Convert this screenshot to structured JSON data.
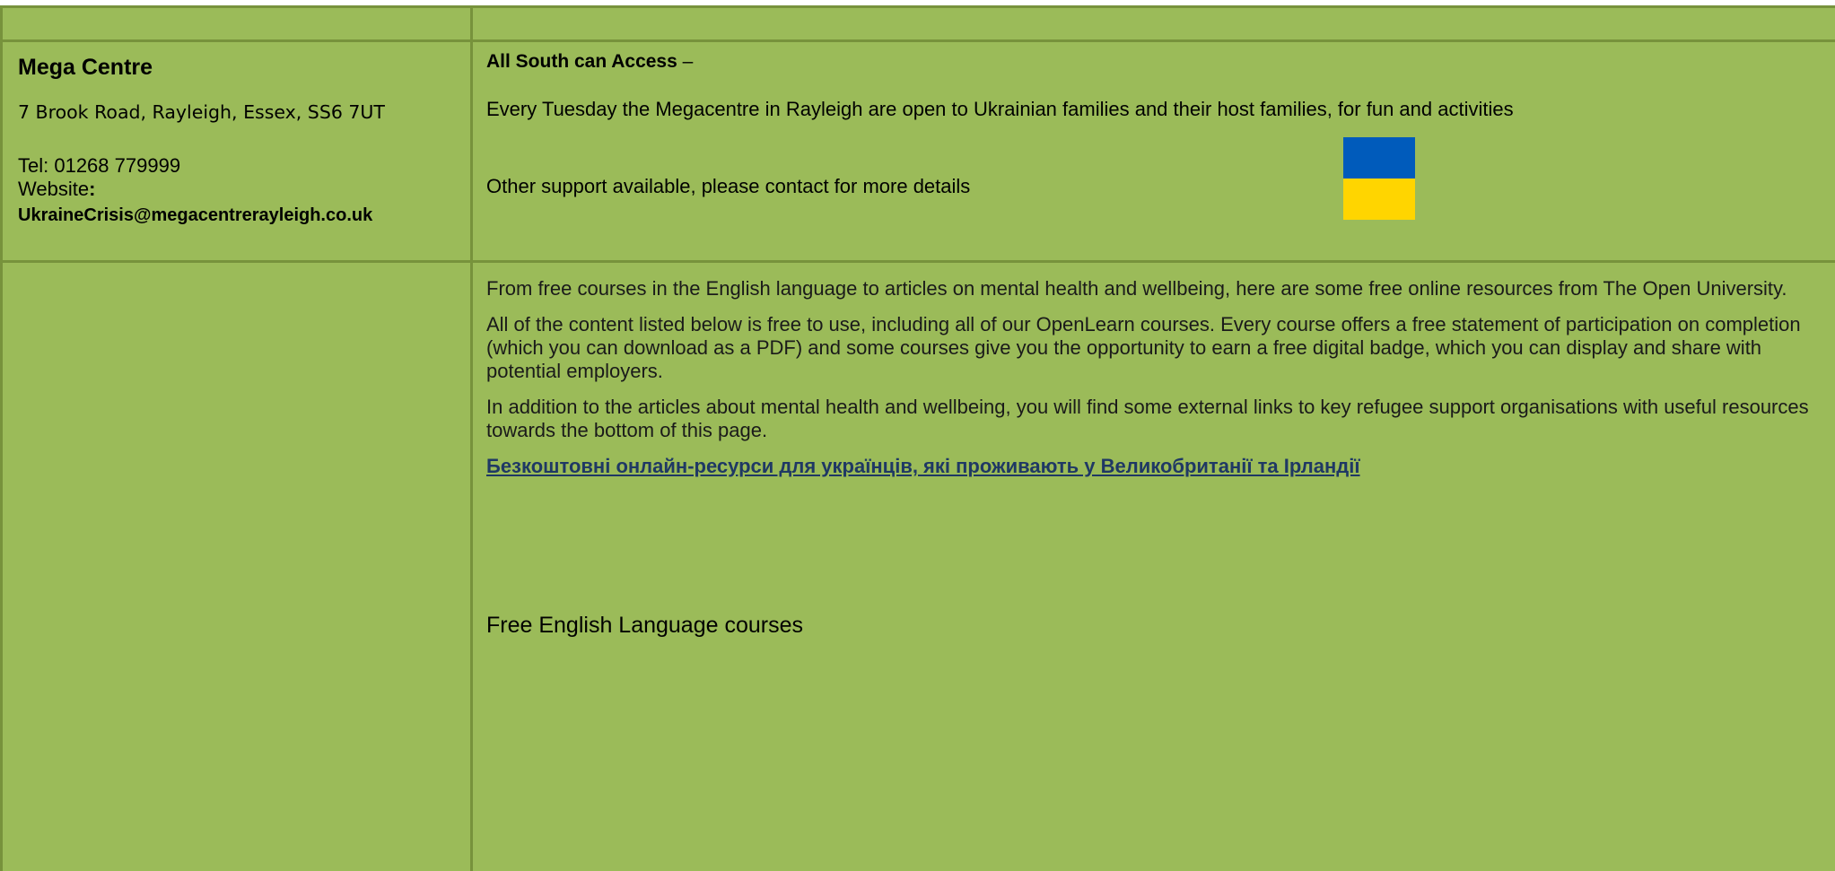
{
  "organisation": {
    "name": "Mega Centre",
    "address": "7 Brook Road, Rayleigh, Essex, SS6 7UT",
    "tel": "Tel: 01268 779999",
    "website_label": "Website",
    "website_colon": ":",
    "email": "UkraineCrisis@megacentrerayleigh.co.uk"
  },
  "service": {
    "access_label": "All South can Access",
    "access_dash": " –",
    "paragraph_1": "Every Tuesday the Megacentre in Rayleigh are open to Ukrainian families and their host families, for fun and activities",
    "paragraph_2": "Other support available, please contact for more details",
    "flag_colors": {
      "top": "#005bbb",
      "bottom": "#ffd500"
    }
  },
  "open_university": {
    "intro": "From free courses in the English language to articles on mental health and wellbeing, here are some free online resources from The Open University.",
    "content_note": "All of the content listed below is free to use, including all of our OpenLearn courses. Every course offers a free statement of participation on completion (which you can download as a PDF) and some courses give you the opportunity to earn a free digital badge, which you can display and share with potential employers.",
    "links_note": "In addition to the articles about mental health and wellbeing, you will find some external links to key refugee support organisations with useful resources towards the bottom of this page.",
    "ukrainian_link": "Безкоштовні онлайн-ресурси для українців, які проживають у Великобританії та Ірландії",
    "english_courses_heading": "Free English Language courses"
  },
  "colors": {
    "cell_background": "#9bbb59",
    "cell_border": "#77923c",
    "link": "#1f3864"
  }
}
